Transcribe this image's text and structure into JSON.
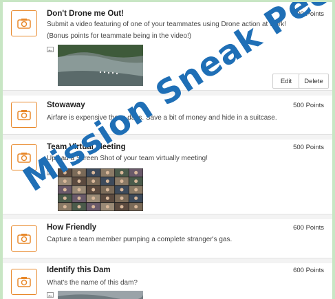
{
  "missions": [
    {
      "title": "Don't Drone me Out!",
      "points": "500 Points",
      "description": "Submit a video featuring of one of your teammates using Drone action at work! (Bonus points for teammate being in the video!)",
      "edit_label": "Edit",
      "delete_label": "Delete"
    },
    {
      "title": "Stowaway",
      "points": "500 Points",
      "description": "Airfare is expensive these days. Save a bit of money and hide in a suitcase."
    },
    {
      "title": "Team Virtual Meeting",
      "points": "500 Points",
      "description": "Upload a Screen Shot of your team virtually meeting!"
    },
    {
      "title": "How Friendly",
      "points": "600 Points",
      "description": "Capture a team member pumping a complete stranger's gas."
    },
    {
      "title": "Identify this Dam",
      "points": "600 Points",
      "description": "What's the name of this dam?"
    }
  ],
  "watermark": "Mission Sneak Peek",
  "colors": {
    "accent": "#e8882a",
    "watermark": "#1f6fb6",
    "frame": "#c8e6c4"
  },
  "icons": {
    "mission": "camera-icon",
    "attachment": "image-icon"
  }
}
